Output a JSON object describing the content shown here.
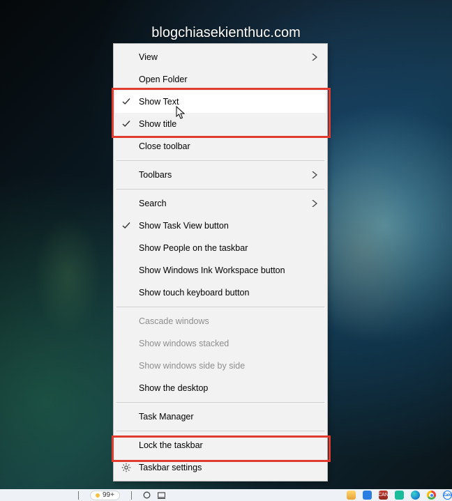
{
  "watermark": "blogchiasekienthuc.com",
  "menu": {
    "view": "View",
    "open_folder": "Open Folder",
    "show_text": "Show Text",
    "show_title": "Show title",
    "close_toolbar": "Close toolbar",
    "toolbars": "Toolbars",
    "search": "Search",
    "show_task_view": "Show Task View button",
    "show_people": "Show People on the taskbar",
    "show_ink": "Show Windows Ink Workspace button",
    "show_touch_kb": "Show touch keyboard button",
    "cascade": "Cascade windows",
    "stacked": "Show windows stacked",
    "side_by_side": "Show windows side by side",
    "show_desktop": "Show the desktop",
    "task_manager": "Task Manager",
    "lock_taskbar": "Lock the taskbar",
    "taskbar_settings": "Taskbar settings"
  },
  "taskbar": {
    "weather_badge": "99+",
    "lang_badge": "CAN",
    "zalo_label": "Zalo"
  }
}
